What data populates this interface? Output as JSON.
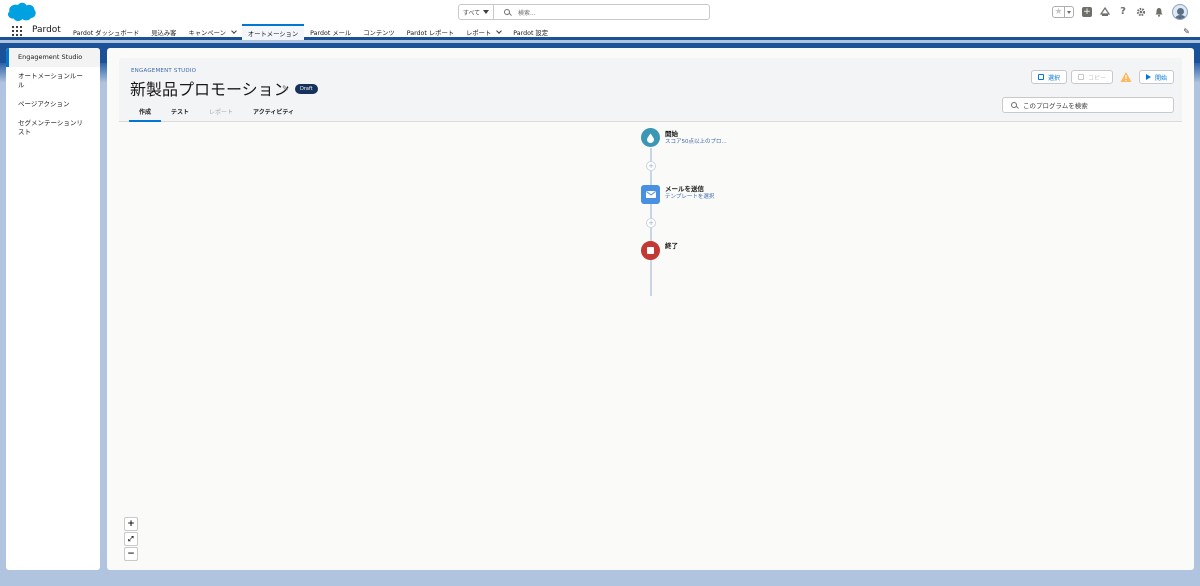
{
  "search": {
    "scope": "すべて",
    "placeholder": "検索..."
  },
  "app_name": "Pardot",
  "nav_tabs": [
    {
      "label": "Pardot ダッシュボード",
      "dropdown": false,
      "active": false
    },
    {
      "label": "見込み客",
      "dropdown": false,
      "active": false
    },
    {
      "label": "キャンペーン",
      "dropdown": true,
      "active": false
    },
    {
      "label": "オートメーション",
      "dropdown": false,
      "active": true
    },
    {
      "label": "Pardot メール",
      "dropdown": false,
      "active": false
    },
    {
      "label": "コンテンツ",
      "dropdown": false,
      "active": false
    },
    {
      "label": "Pardot レポート",
      "dropdown": false,
      "active": false
    },
    {
      "label": "レポート",
      "dropdown": true,
      "active": false
    },
    {
      "label": "Pardot 設定",
      "dropdown": false,
      "active": false
    }
  ],
  "sidebar": {
    "items": [
      {
        "label": "Engagement Studio",
        "active": true
      },
      {
        "label": "オートメーションルール",
        "active": false
      },
      {
        "label": "ページアクション",
        "active": false
      },
      {
        "label": "セグメンテーションリスト",
        "active": false
      }
    ]
  },
  "program": {
    "eyebrow": "ENGAGEMENT STUDIO",
    "title": "新製品プロモーション",
    "badge": "Draft",
    "tabs": [
      {
        "label": "作成",
        "active": true,
        "disabled": false
      },
      {
        "label": "テスト",
        "active": false,
        "disabled": false
      },
      {
        "label": "レポート",
        "active": false,
        "disabled": true
      },
      {
        "label": "アクティビティ",
        "active": false,
        "disabled": false
      }
    ],
    "actions": {
      "select": "選択",
      "copy": "コピー",
      "start": "開始"
    },
    "search_placeholder": "このプログラムを検索"
  },
  "flow": {
    "start": {
      "title": "開始",
      "subtitle": "スコア50点以上のプロ..."
    },
    "email": {
      "title": "メールを送信",
      "subtitle": "テンプレートを選択"
    },
    "end": {
      "title": "終了"
    }
  },
  "colors": {
    "brand_blue": "#1b5297",
    "accent": "#0176d3",
    "start_node": "#3c97b5",
    "email_node": "#4a90e2",
    "end_node": "#c23934",
    "warning": "#ffb75d"
  }
}
